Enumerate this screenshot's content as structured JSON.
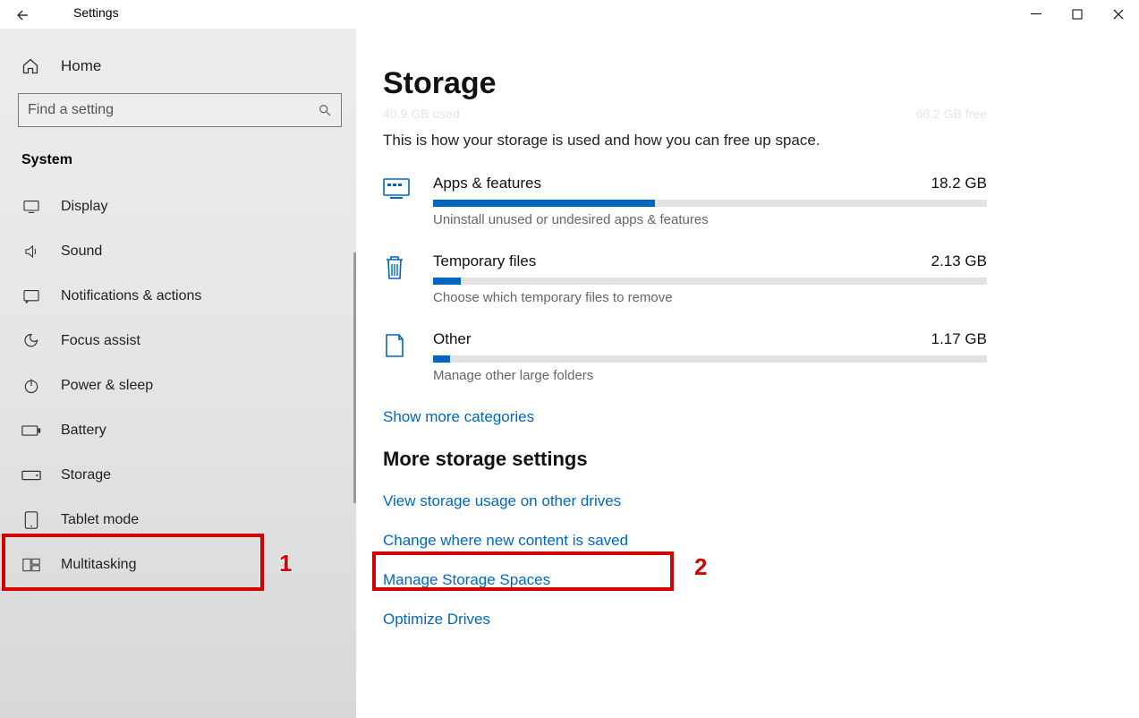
{
  "titlebar": {
    "app": "Settings"
  },
  "sidebar": {
    "home": "Home",
    "search_placeholder": "Find a setting",
    "section": "System",
    "items": [
      {
        "label": "Display"
      },
      {
        "label": "Sound"
      },
      {
        "label": "Notifications & actions"
      },
      {
        "label": "Focus assist"
      },
      {
        "label": "Power & sleep"
      },
      {
        "label": "Battery"
      },
      {
        "label": "Storage"
      },
      {
        "label": "Tablet mode"
      },
      {
        "label": "Multitasking"
      }
    ]
  },
  "main": {
    "title": "Storage",
    "ghost_used": "40.9 GB used",
    "ghost_free": "68.2 GB free",
    "desc": "This is how your storage is used and how you can free up space.",
    "cats": [
      {
        "name": "Apps & features",
        "size": "18.2 GB",
        "sub": "Uninstall unused or undesired apps & features",
        "fill": 40
      },
      {
        "name": "Temporary files",
        "size": "2.13 GB",
        "sub": "Choose which temporary files to remove",
        "fill": 5
      },
      {
        "name": "Other",
        "size": "1.17 GB",
        "sub": "Manage other large folders",
        "fill": 3
      }
    ],
    "show_more": "Show more categories",
    "more_head": "More storage settings",
    "links": [
      "View storage usage on other drives",
      "Change where new content is saved",
      "Manage Storage Spaces",
      "Optimize Drives"
    ]
  },
  "annotations": {
    "n1": "1",
    "n2": "2"
  }
}
